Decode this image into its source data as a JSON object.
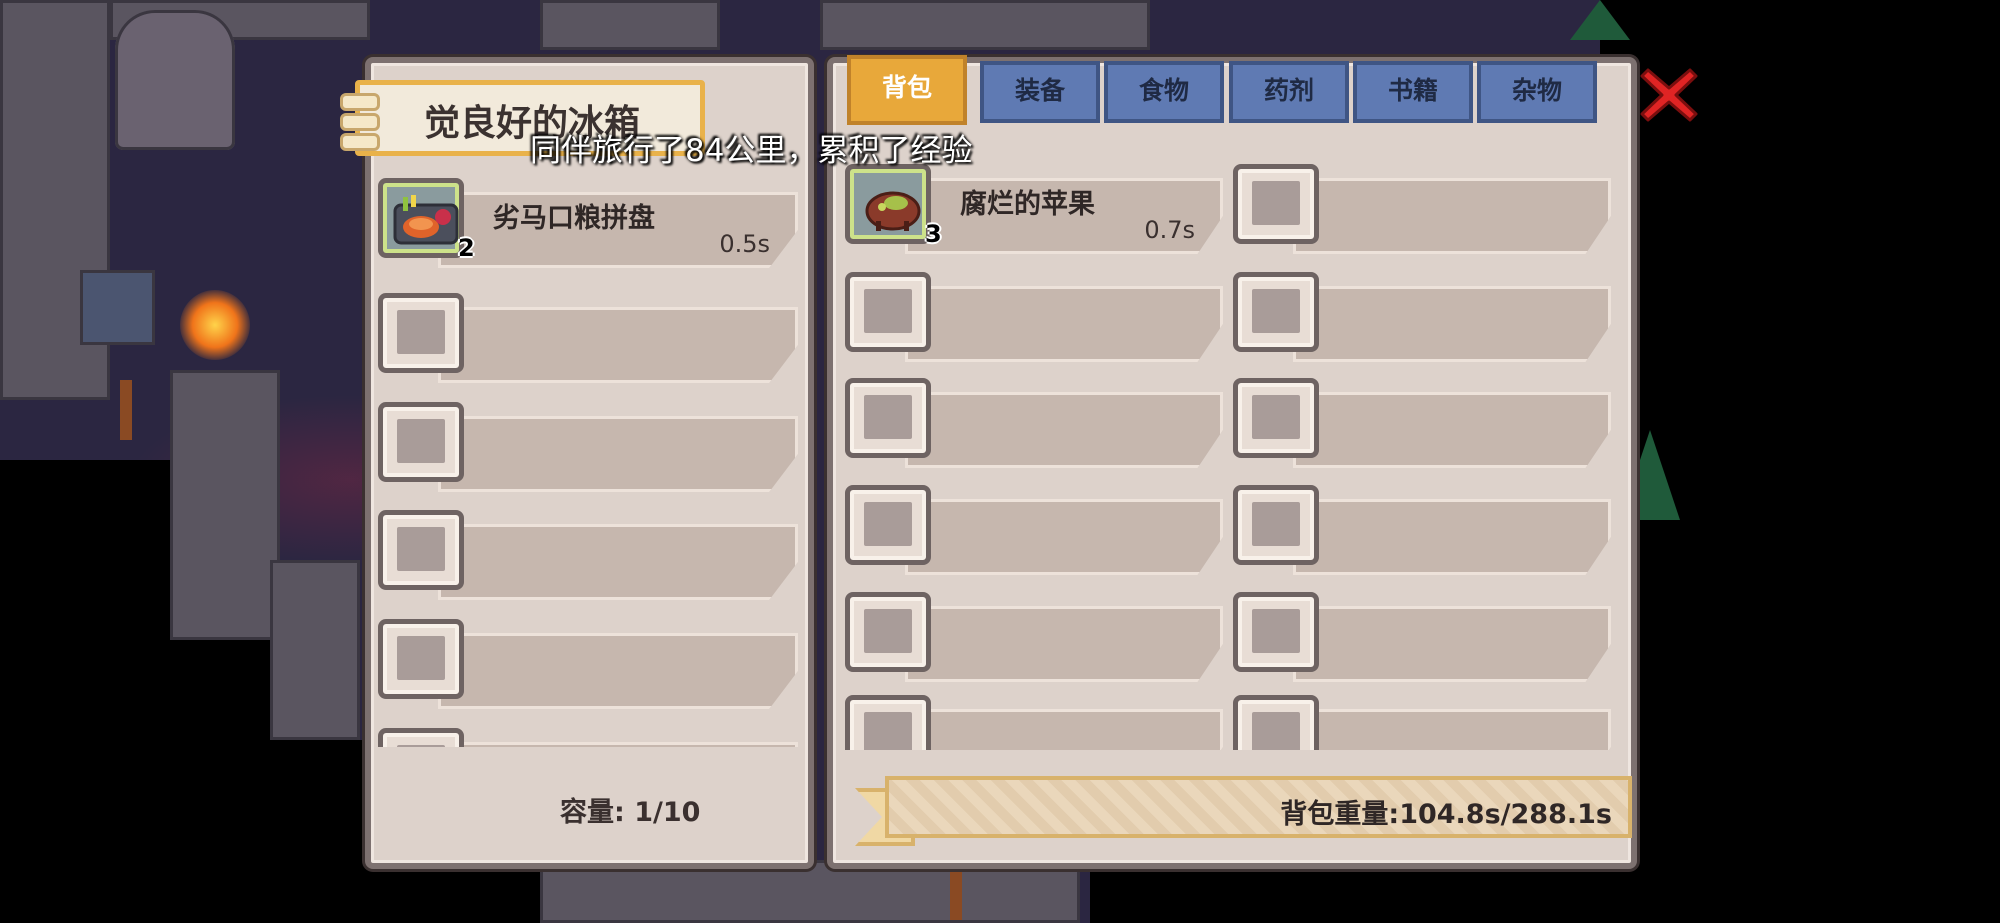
{
  "chest": {
    "title": "觉良好的冰箱",
    "capacity_label": "容量: 1/10",
    "items": [
      {
        "name": "劣马口粮拼盘",
        "weight": "0.5s",
        "count": "2"
      }
    ]
  },
  "notification": "同伴旅行了84公里，累积了经验",
  "bag": {
    "tabs": [
      {
        "label": "背包",
        "active": true
      },
      {
        "label": "装备",
        "active": false
      },
      {
        "label": "食物",
        "active": false
      },
      {
        "label": "药剂",
        "active": false
      },
      {
        "label": "书籍",
        "active": false
      },
      {
        "label": "杂物",
        "active": false
      }
    ],
    "items": [
      {
        "name": "腐烂的苹果",
        "weight": "0.7s",
        "count": "3"
      }
    ],
    "weight_label": "背包重量:104.8s/288.1s"
  },
  "icons": {
    "close": "close-x-icon",
    "chest_item": "ration-platter-icon",
    "bag_item": "rotten-apple-icon"
  },
  "colors": {
    "panel_bg": "#ddd2cb",
    "tab_active": "#e8a83a",
    "tab_inactive": "#5f7ab3",
    "close_red": "#e02424"
  }
}
